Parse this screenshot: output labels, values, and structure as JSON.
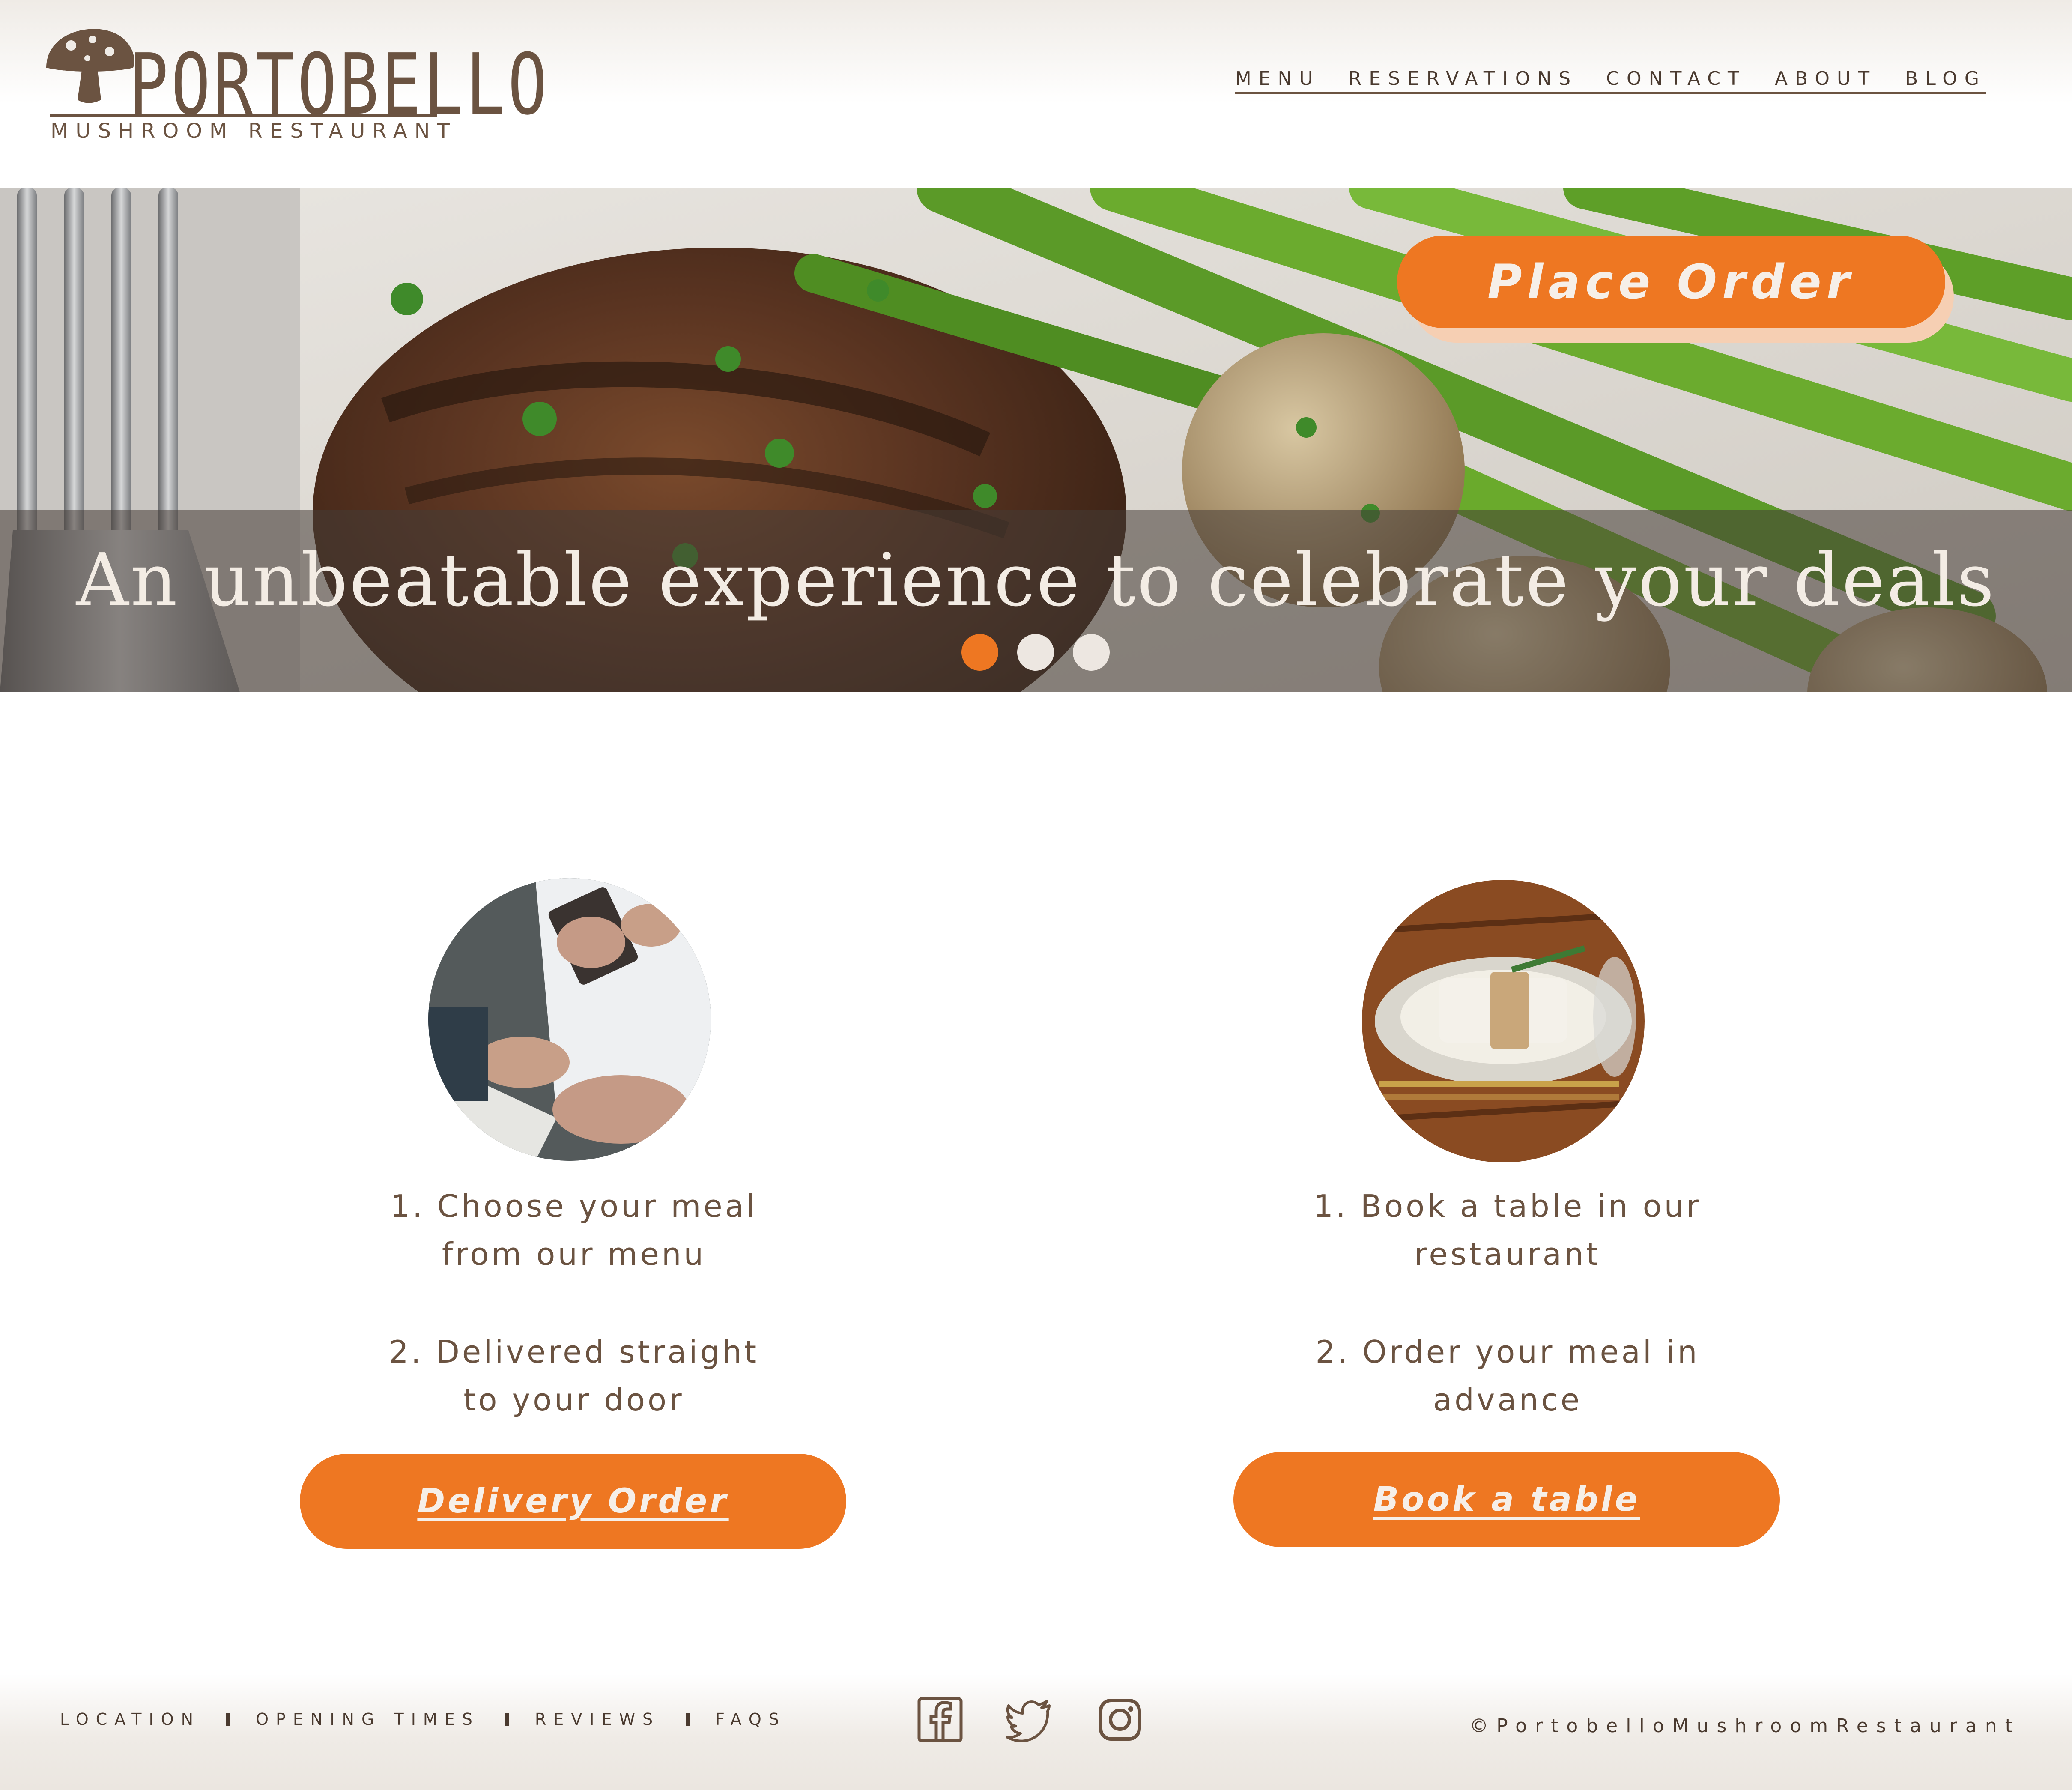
{
  "brand": {
    "name": "PORTOBELLO",
    "subtitle": "MUSHROOM RESTAURANT"
  },
  "nav": {
    "items": [
      "MENU",
      "RESERVATIONS",
      "CONTACT",
      "ABOUT",
      "BLOG"
    ]
  },
  "hero": {
    "headline": "An unbeatable experience to celebrate your deals",
    "cta_label": "Place Order",
    "carousel_total": 3,
    "carousel_active": 1
  },
  "cards": [
    {
      "steps": [
        "1. Choose your meal\nfrom our menu",
        "2. Delivered straight\nto your door"
      ],
      "button_label": "Delivery Order",
      "photo": "waiter-taking-order-photo"
    },
    {
      "steps": [
        "1. Book a table in our\nrestaurant",
        "2. Order your meal in\nadvance"
      ],
      "button_label": "Book a table",
      "photo": "table-setting-photo"
    }
  ],
  "footer": {
    "links": [
      "LOCATION",
      "OPENING TIMES",
      "REVIEWS",
      "FAQS"
    ],
    "social": [
      "facebook-icon",
      "twitter-icon",
      "instagram-icon"
    ],
    "copyright": "©PortobelloMushroomRestaurant"
  },
  "colors": {
    "accent": "#ee7722",
    "brown": "#6b5341",
    "cream": "#efebe6"
  }
}
